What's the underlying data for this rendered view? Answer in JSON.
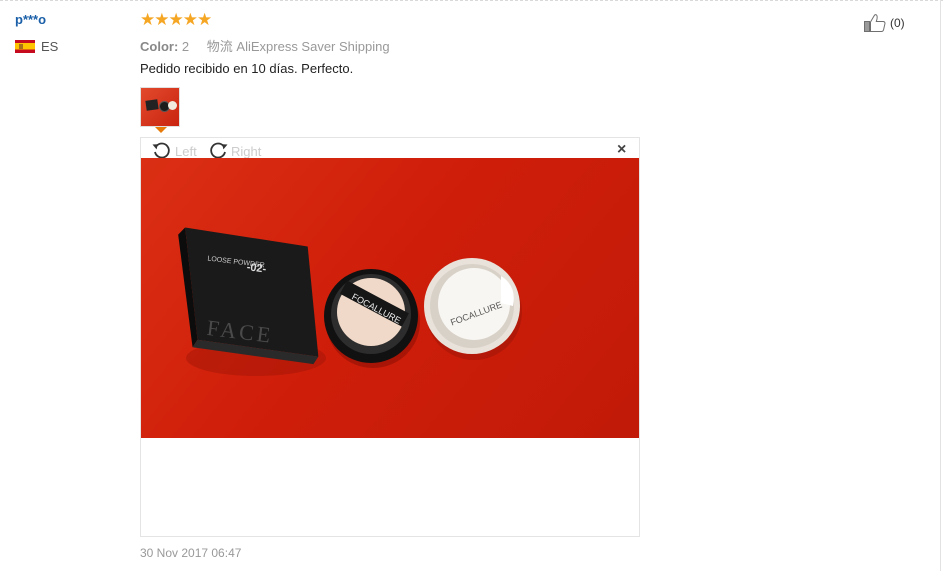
{
  "review": {
    "user_name": "p***o",
    "country_code": "ES",
    "rating_stars": "★★★★★",
    "rating": 5,
    "color_label": "Color:",
    "color_value": "2",
    "shipping_prefix": "物流",
    "shipping_method": "AliExpress Saver Shipping",
    "text": "Pedido recibido en 10 días. Perfecto.",
    "helpful_count": "(0)",
    "date": "30 Nov 2017 06:47"
  },
  "viewer": {
    "rotate_left_label": "Left",
    "rotate_right_label": "Right",
    "close_glyph": "×"
  },
  "photo": {
    "box_label": "LOOSE POWDER",
    "box_shade": "-02-",
    "box_brand": "FACE",
    "puff_brand": "FOCALLURE",
    "lid_brand": "FOCALLURE"
  },
  "colors": {
    "star": "#f5a623",
    "username": "#1a5fa8",
    "selected_thumb": "#e67b0a"
  }
}
